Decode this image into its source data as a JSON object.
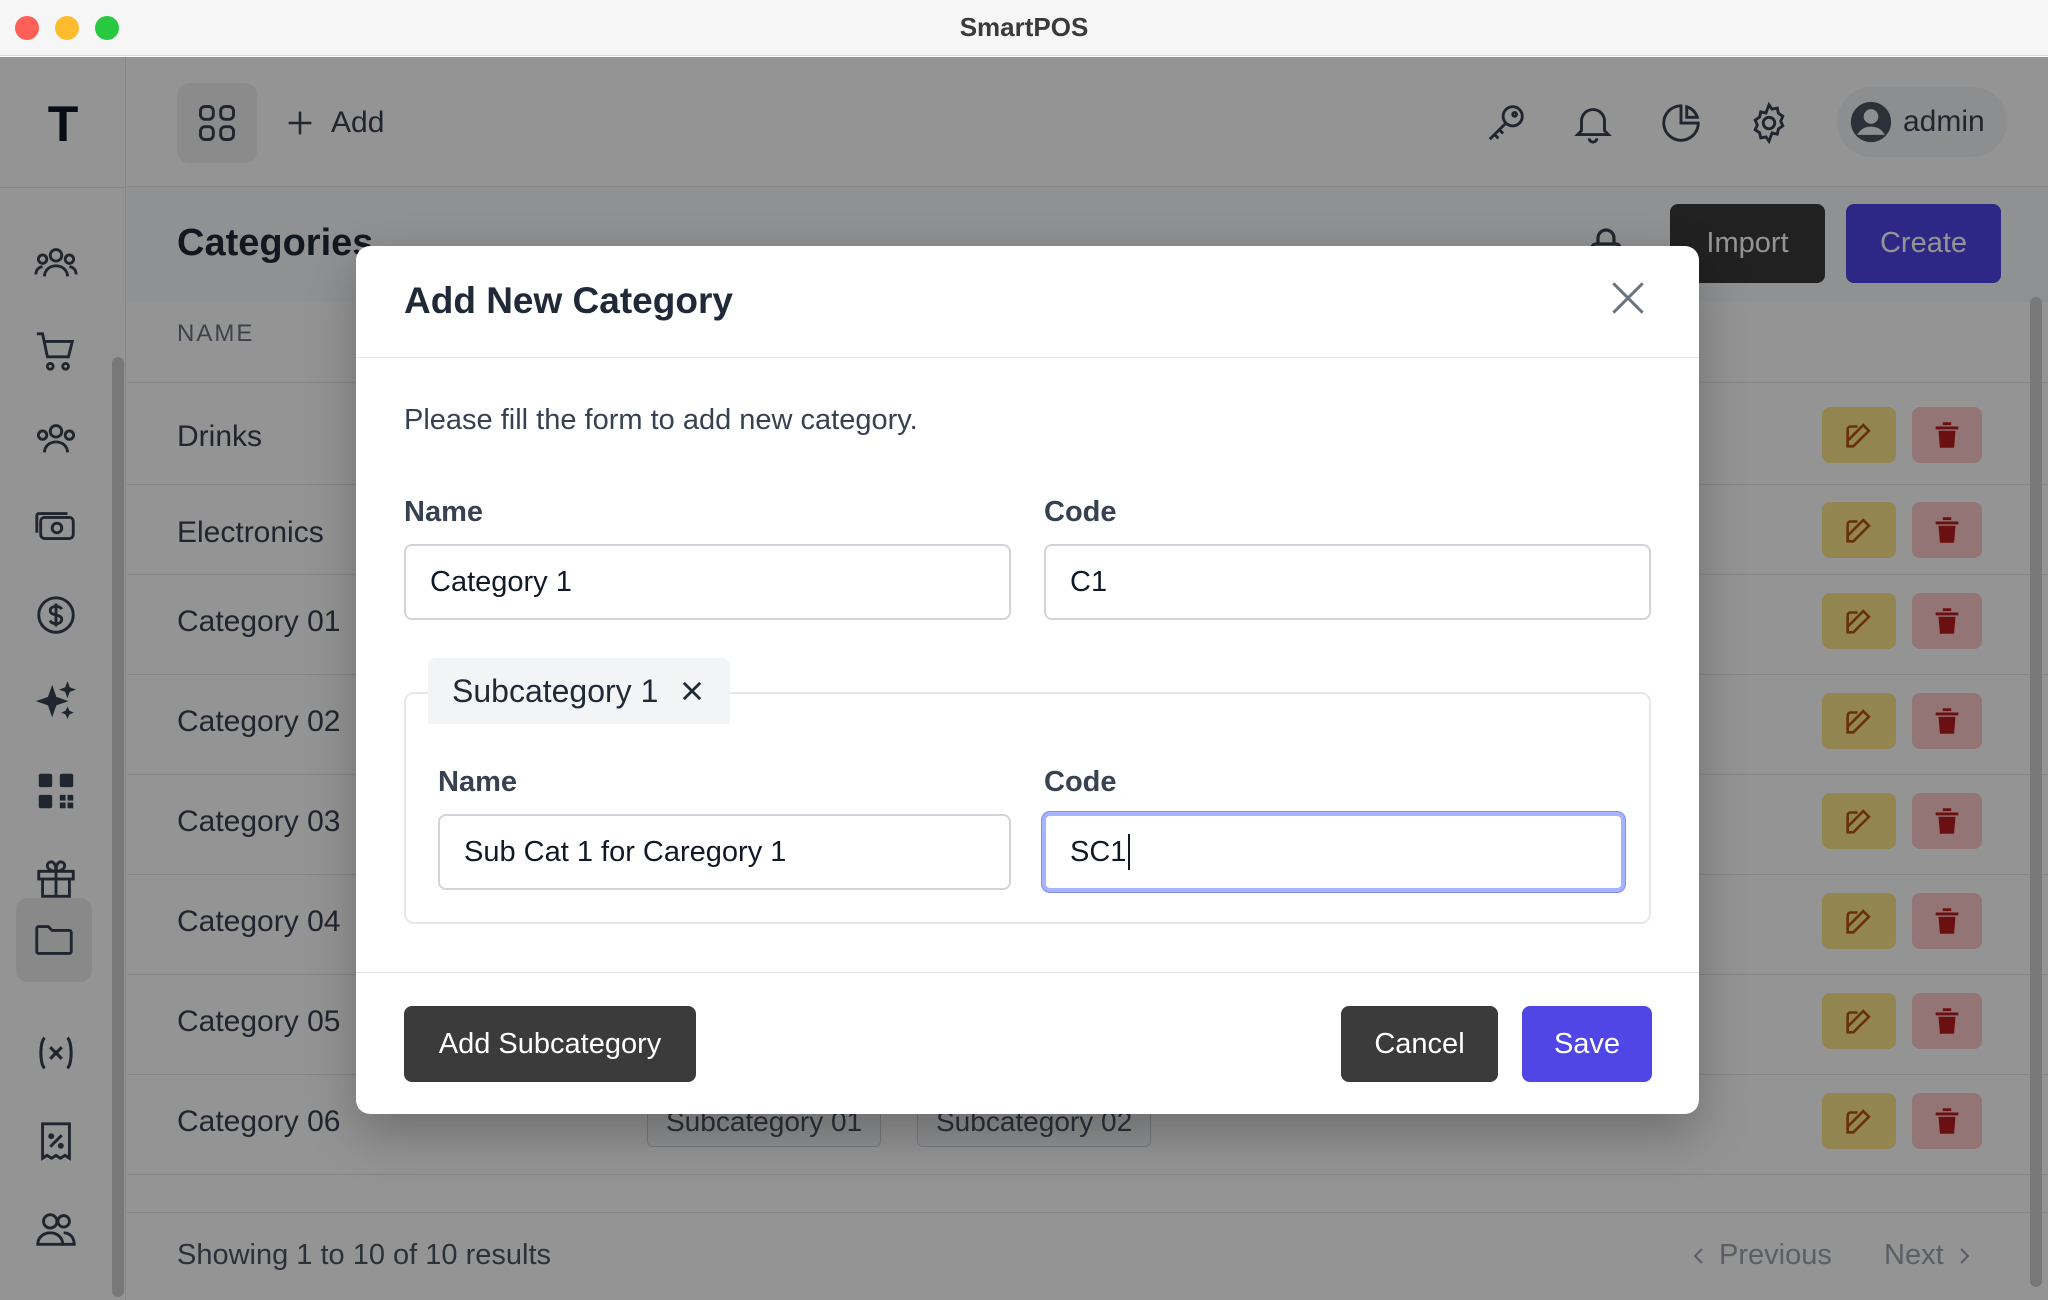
{
  "window": {
    "title": "SmartPOS"
  },
  "sidebar": {
    "logo": "T",
    "items": [
      {
        "icon": "users-group-icon"
      },
      {
        "icon": "cart-icon"
      },
      {
        "icon": "customers-icon"
      },
      {
        "icon": "cash-icon"
      },
      {
        "icon": "dollar-icon"
      },
      {
        "icon": "sparkles-icon"
      },
      {
        "icon": "qr-code-icon"
      },
      {
        "icon": "gift-icon"
      },
      {
        "icon": "folder-icon",
        "active": true
      },
      {
        "icon": "variable-icon"
      },
      {
        "icon": "discount-icon"
      },
      {
        "icon": "team-icon"
      }
    ]
  },
  "topbar": {
    "add_label": "Add",
    "user_label": "admin"
  },
  "page": {
    "title": "Categories",
    "import_label": "Import",
    "create_label": "Create",
    "table_header_name": "NAME"
  },
  "table": {
    "rows": [
      {
        "name": "Drinks",
        "subcategories": []
      },
      {
        "name": "Electronics",
        "subcategories": []
      },
      {
        "name": "Category 01",
        "subcategories": []
      },
      {
        "name": "Category 02",
        "subcategories": []
      },
      {
        "name": "Category 03",
        "subcategories": []
      },
      {
        "name": "Category 04",
        "subcategories": []
      },
      {
        "name": "Category 05",
        "subcategories": []
      },
      {
        "name": "Category 06",
        "subcategories": [
          "Subcategory 01",
          "Subcategory 02"
        ]
      }
    ]
  },
  "footer": {
    "results_text": "Showing 1 to 10 of 10 results",
    "previous_label": "Previous",
    "next_label": "Next"
  },
  "modal": {
    "title": "Add New Category",
    "description": "Please fill the form to add new category.",
    "name_label": "Name",
    "name_value": "Category 1",
    "code_label": "Code",
    "code_value": "C1",
    "subcategory": {
      "tab_label": "Subcategory 1",
      "name_label": "Name",
      "name_value": "Sub Cat 1 for Caregory 1",
      "code_label": "Code",
      "code_value": "SC1"
    },
    "add_subcategory_label": "Add Subcategory",
    "cancel_label": "Cancel",
    "save_label": "Save"
  },
  "colors": {
    "primary": "#4f46e5",
    "dark_button": "#3b3b3b",
    "edit": "#fde68a",
    "delete": "#fecaca",
    "focus_ring": "#a5b4fc"
  }
}
